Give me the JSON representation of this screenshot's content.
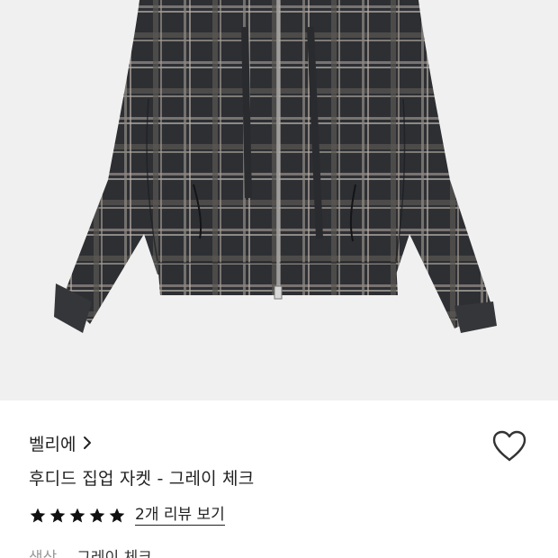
{
  "product": {
    "brand": "벨리에",
    "title": "후디드 집업 자켓 - 그레이 체크",
    "rating_stars": 5,
    "review_link": "2개 리뷰 보기",
    "option_label": "색상",
    "option_value": "그레이 체크"
  },
  "icons": {
    "brand_chevron": "chevron-right-icon",
    "wishlist": "heart-outline-icon",
    "star": "star-filled-icon"
  },
  "colors": {
    "image_background": "#f0f0f0",
    "text_primary": "#222222",
    "text_secondary": "#999999",
    "star": "#111111"
  }
}
